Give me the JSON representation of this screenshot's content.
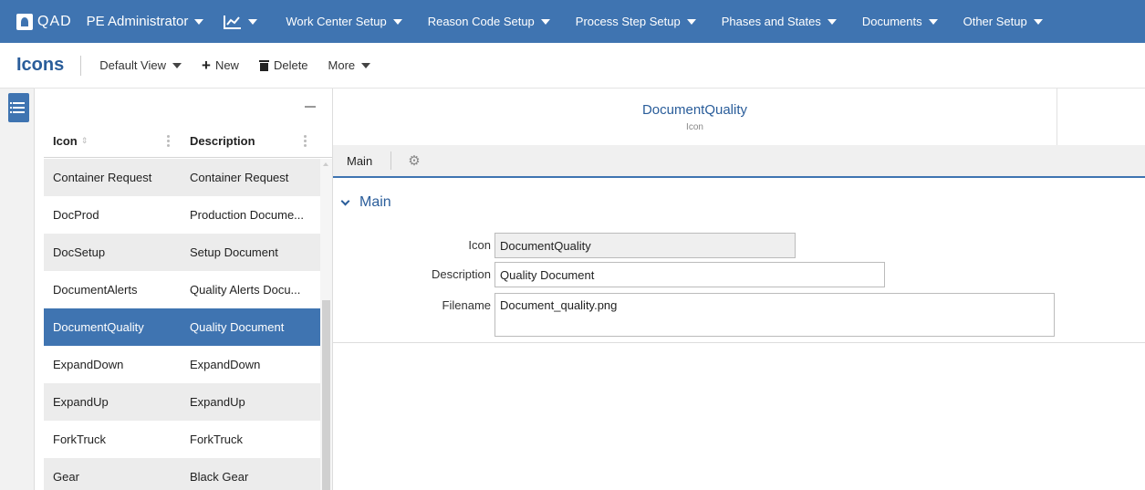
{
  "topnav": {
    "brand": "QAD",
    "role": "PE Administrator",
    "analytics_icon": "line-chart-icon",
    "menus": [
      {
        "label": "Work Center Setup"
      },
      {
        "label": "Reason Code Setup"
      },
      {
        "label": "Process Step Setup"
      },
      {
        "label": "Phases and States"
      },
      {
        "label": "Documents"
      },
      {
        "label": "Other Setup"
      }
    ]
  },
  "toolbar": {
    "title": "Icons",
    "view": "Default View",
    "new_label": "New",
    "delete_label": "Delete",
    "more_label": "More"
  },
  "grid": {
    "columns": [
      "Icon",
      "Description"
    ],
    "rows": [
      {
        "icon": "Container Request",
        "description": "Container Request"
      },
      {
        "icon": "DocProd",
        "description": "Production Docume..."
      },
      {
        "icon": "DocSetup",
        "description": "Setup Document"
      },
      {
        "icon": "DocumentAlerts",
        "description": "Quality Alerts Docu..."
      },
      {
        "icon": "DocumentQuality",
        "description": "Quality Document"
      },
      {
        "icon": "ExpandDown",
        "description": "ExpandDown"
      },
      {
        "icon": "ExpandUp",
        "description": "ExpandUp"
      },
      {
        "icon": "ForkTruck",
        "description": "ForkTruck"
      },
      {
        "icon": "Gear",
        "description": "Black Gear"
      }
    ],
    "selected_index": 4
  },
  "detail": {
    "title": "DocumentQuality",
    "subtitle": "Icon",
    "tab": "Main",
    "section": "Main",
    "fields": {
      "icon_label": "Icon",
      "icon_value": "DocumentQuality",
      "description_label": "Description",
      "description_value": "Quality Document",
      "filename_label": "Filename",
      "filename_value": "Document_quality.png"
    }
  },
  "colors": {
    "accent": "#3f74b1",
    "title_blue": "#2a5d9a"
  }
}
